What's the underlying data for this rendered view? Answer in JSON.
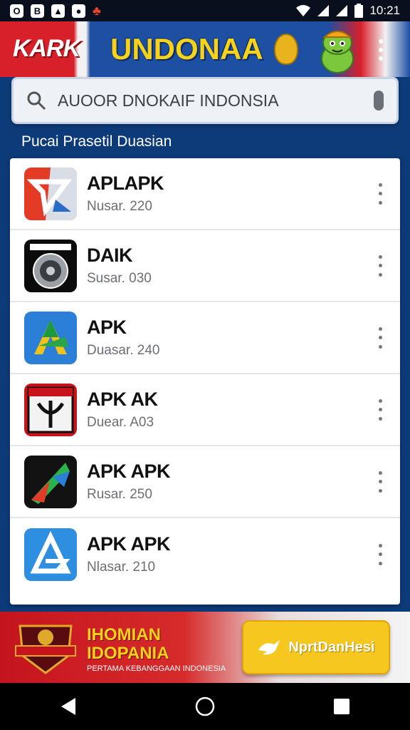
{
  "status_bar": {
    "time": "10:21",
    "left_icons": [
      "o-notification-icon",
      "b-notification-icon",
      "image-notification-icon",
      "game-notification-icon",
      "app-notification-icon"
    ],
    "right_icons": [
      "wifi-icon",
      "signal-icon",
      "signal-icon",
      "battery-icon"
    ]
  },
  "header": {
    "logo_text": "KARK",
    "title": "UNDONAA"
  },
  "search": {
    "placeholder": "AUOOR DNOKAIF INDONSIA"
  },
  "section": {
    "heading": "Pucai Prasetil Duasian"
  },
  "apps": [
    {
      "name": "APLAPK",
      "meta": "Nusar. 220",
      "icon": "red-star-icon"
    },
    {
      "name": "DAIK",
      "meta": "Susar. 030",
      "icon": "safe-dial-icon"
    },
    {
      "name": "APK",
      "meta": "Duasar. 240",
      "icon": "green-a-icon"
    },
    {
      "name": "APK AK",
      "meta": "Duear. A03",
      "icon": "red-emblem-icon"
    },
    {
      "name": "APK APK",
      "meta": "Rusar. 250",
      "icon": "play-triangle-icon"
    },
    {
      "name": "APK APK",
      "meta": "Nlasar. 210",
      "icon": "blue-a-icon"
    }
  ],
  "promo": {
    "title_line1": "IHOMIAN",
    "title_line2": "IDOPANIA",
    "subtitle": "PERTAMA KEBANGGAAN INDONESIA",
    "button_label": "NprtDanHesi"
  },
  "colors": {
    "header_red": "#d8202a",
    "header_blue": "#1d4fa3",
    "title_yellow": "#f6d21a",
    "background_blue": "#0d3a78",
    "button_yellow": "#f6c71e"
  }
}
